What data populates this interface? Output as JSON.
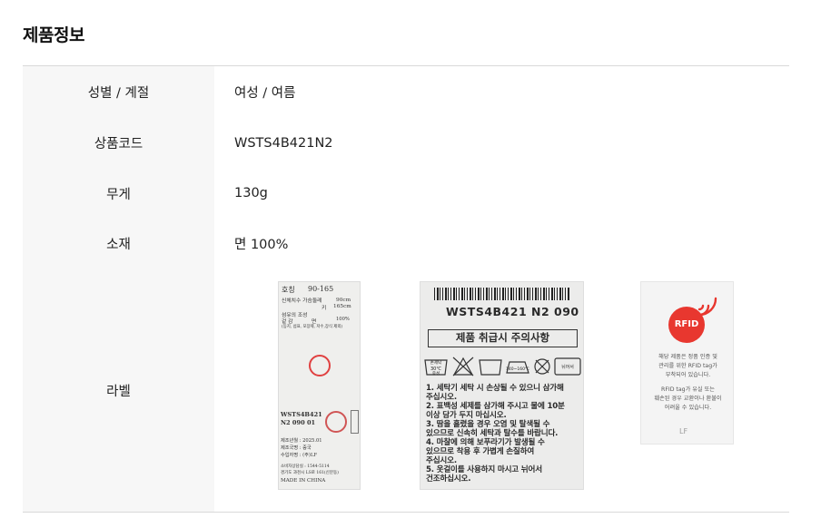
{
  "section_title": "제품정보",
  "rows": [
    {
      "label": "성별 / 계절",
      "value": "여성 / 여름"
    },
    {
      "label": "상품코드",
      "value": "WSTS4B421N2"
    },
    {
      "label": "무게",
      "value": "130g"
    },
    {
      "label": "소재",
      "value": "면 100%"
    },
    {
      "label": "라벨",
      "value": ""
    }
  ],
  "label1": {
    "size_label": "호칭",
    "size_value": "90-165",
    "body_label": "신체치수 가슴둘레",
    "chest": "90cm",
    "height_label": "키",
    "height": "165cm",
    "fiber_label": "섬유의 조성",
    "part": "겉 감",
    "material": "면",
    "percent": "100%",
    "note": "(등지, 섬표, 포장제, 저수,장식 제외)",
    "code1": "WSTS4B421",
    "code2": "N2  090  01",
    "date": "제조년월 : 2025.01",
    "country": "제조국명 : 중국",
    "importer": "수입자명 : (주)LF",
    "consumer": "소비자상담실 : 1544-5114",
    "address": "경기도 과천시 LS로 161(신분동)",
    "made_in": "MADE IN CHINA"
  },
  "label2": {
    "code": "WSTS4B421 N2 090",
    "care_title": "제품 취급시 주의사항",
    "icon_hand": "손세탁",
    "icon_temp": "30℃",
    "icon_neutral": "중성",
    "icon_iron": "140~160℃",
    "icon_flat": "뉘어서",
    "notes": [
      "1. 세탁기 세탁 시 손상될 수 있으니 삼가해",
      "   주십시오.",
      "2. 표백성 세제를 삼가해 주시고 물에 10분",
      "   이상 담가 두지 마십시오.",
      "3. 땀을 흘렸을 경우 오염 및 탈색될 수",
      "   있으므로 신속히 세탁과 탈수를 바랍니다.",
      "4. 마찰에 의해 보푸라기가 발생될 수",
      "   있으므로 착용 후 가볍게 손질하여",
      "   주십시오.",
      "5. 옷걸이를 사용하지 마시고 뉘어서",
      "   건조하십시오."
    ]
  },
  "label3": {
    "badge": "RFID",
    "text1": "해당 제품은 정품 인증 및",
    "text2": "관리를 위한 RFID tag가",
    "text3": "부착되어 있습니다.",
    "text4": "RFID tag가 유실 또는",
    "text5": "훼손된 경우 교환이나 환불이",
    "text6": "어려울 수 있습니다.",
    "brand": "LF"
  },
  "colors": {
    "rfid_red": "#e8372f",
    "header_bg": "#f7f7f7",
    "border": "#d9d9d9"
  }
}
